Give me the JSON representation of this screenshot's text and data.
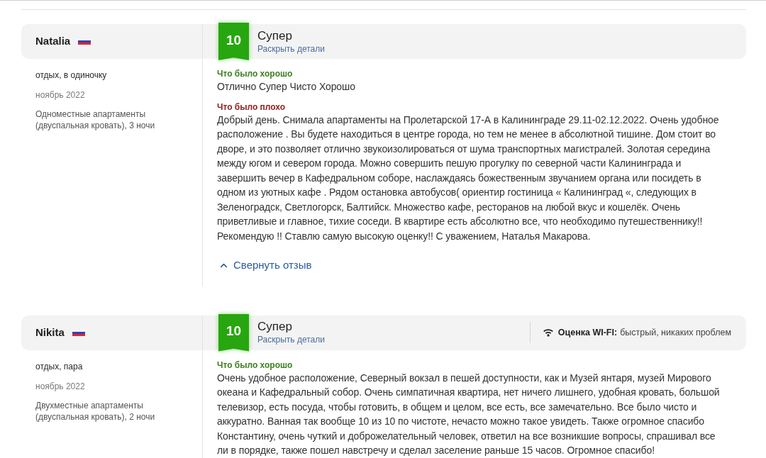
{
  "reviews": [
    {
      "author": "Natalia",
      "trip_type": "отдых, в одиночку",
      "date": "ноябрь 2022",
      "room": "Одноместные апартаменты (двуспальная кровать), 3 ночи",
      "score": "10",
      "score_label": "Супер",
      "details_link": "Раскрыть детали",
      "sections": [
        {
          "kind": "positive",
          "heading": "Что было хорошо",
          "text": "Отлично Супер Чисто Хорошо"
        },
        {
          "kind": "negative",
          "heading": "Что было плохо",
          "text": "Добрый день. Снимала апартаменты на Пролетарской 17-А в Калининграде 29.11-02.12.2022. Очень удобное расположение . Вы будете находиться в центре города, но тем не менее в абсолютной тишине. Дом стоит во дворе, и это позволяет отлично звукоизолироваться от шума транспортных магистралей. Золотая середина между югом и севером города. Можно совершить пешую прогулку по северной части Калининграда и завершить вечер в Кафедральном соборе, наслаждаясь божественным звучанием органа или посидеть в одном из уютных кафе . Рядом остановка автобусов( ориентир гостиница « Калининград «, следующих в Зеленоградск, Светлогорск, Балтийск. Множество кафе, ресторанов на любой вкус и кошелёк. Очень приветливые и главное, тихие соседи. В квартире есть абсолютно все, что необходимо путешественнику!! Рекомендую !! Ставлю самую высокую оценку!! С уважением, Наталья Макарова."
        }
      ],
      "collapse_link": "Свернуть отзыв"
    },
    {
      "author": "Nikita",
      "trip_type": "отдых, пара",
      "date": "ноябрь 2022",
      "room": "Двухместные апартаменты (двуспальная кровать), 2 ночи",
      "score": "10",
      "score_label": "Супер",
      "details_link": "Раскрыть детали",
      "wifi": {
        "label": "Оценка WI-FI:",
        "value": "быстрый, никаких проблем"
      },
      "sections": [
        {
          "kind": "positive",
          "heading": "Что было хорошо",
          "text": "Очень удобное расположение, Северный вокзал в пешей доступности, как и Музей янтаря, музей Мирового океана и Кафедральный собор. Очень симпатичная квартира, нет ничего лишнего, удобная кровать, большой телевизор, есть посуда, чтобы готовить, в общем и целом, все есть, все замечательно. Все было чисто и аккуратно. Ванная так вообще 10 из 10 по чистоте, нечасто можно такое увидеть. Также огромное спасибо Константину, очень чуткий и доброжелательный человек, ответил на все возникшие вопросы, спрашивал все ли в порядке, также пошел навстречу и сделал заселение раньше 15 часов. Огромное спасибо!"
        }
      ]
    }
  ]
}
